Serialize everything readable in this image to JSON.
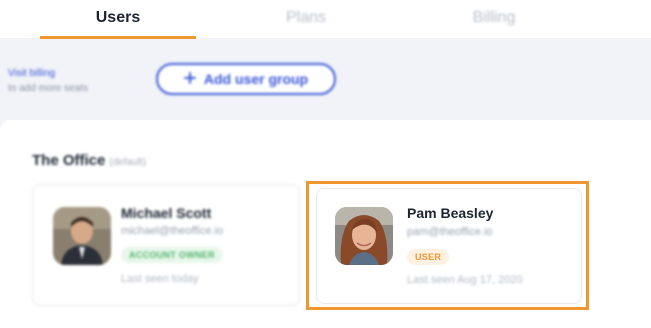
{
  "tabs": [
    {
      "label": "Users"
    },
    {
      "label": "Plans"
    },
    {
      "label": "Billing"
    }
  ],
  "toolbar": {
    "billing_link": "Visit billing",
    "billing_sub": "to add more seats",
    "add_group_label": "Add user group",
    "add_icon": "plus-icon"
  },
  "group": {
    "name": "The Office",
    "tag": "(default)"
  },
  "members": [
    {
      "name": "Michael Scott",
      "email": "michael@theoffice.io",
      "role": "ACCOUNT OWNER",
      "last_seen": "Last seen today"
    },
    {
      "name": "Pam Beasley",
      "email": "pam@theoffice.io",
      "role": "USER",
      "last_seen": "Last seen Aug 17, 2020"
    }
  ],
  "colors": {
    "accent": "#f0972f",
    "link": "#3a57d6",
    "background": "#f1f3f8"
  }
}
